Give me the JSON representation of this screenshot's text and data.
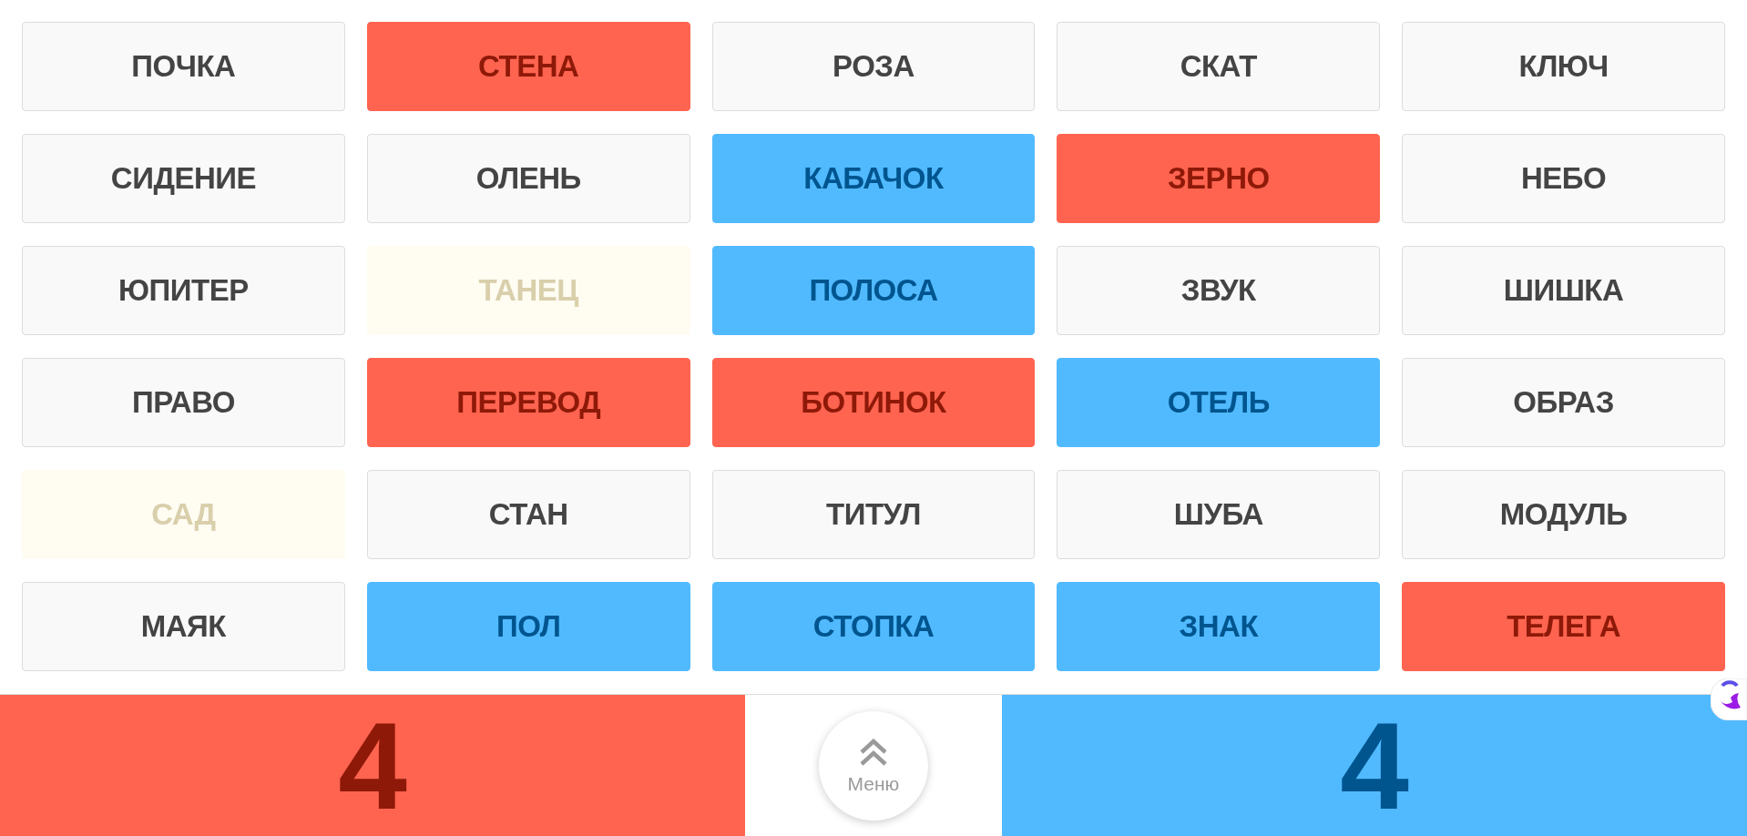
{
  "board": {
    "cards": [
      {
        "word": "ПОЧКА",
        "kind": "plain"
      },
      {
        "word": "СТЕНА",
        "kind": "red"
      },
      {
        "word": "РОЗА",
        "kind": "plain"
      },
      {
        "word": "СКАТ",
        "kind": "plain"
      },
      {
        "word": "КЛЮЧ",
        "kind": "plain"
      },
      {
        "word": "СИДЕНИЕ",
        "kind": "plain"
      },
      {
        "word": "ОЛЕНЬ",
        "kind": "plain"
      },
      {
        "word": "КАБАЧОК",
        "kind": "blue"
      },
      {
        "word": "ЗЕРНО",
        "kind": "red"
      },
      {
        "word": "НЕБО",
        "kind": "plain"
      },
      {
        "word": "ЮПИТЕР",
        "kind": "plain"
      },
      {
        "word": "ТАНЕЦ",
        "kind": "faded"
      },
      {
        "word": "ПОЛОСА",
        "kind": "blue"
      },
      {
        "word": "ЗВУК",
        "kind": "plain"
      },
      {
        "word": "ШИШКА",
        "kind": "plain"
      },
      {
        "word": "ПРАВО",
        "kind": "plain"
      },
      {
        "word": "ПЕРЕВОД",
        "kind": "red"
      },
      {
        "word": "БОТИНОК",
        "kind": "red"
      },
      {
        "word": "ОТЕЛЬ",
        "kind": "blue"
      },
      {
        "word": "ОБРАЗ",
        "kind": "plain"
      },
      {
        "word": "САД",
        "kind": "faded"
      },
      {
        "word": "СТАН",
        "kind": "plain"
      },
      {
        "word": "ТИТУЛ",
        "kind": "plain"
      },
      {
        "word": "ШУБА",
        "kind": "plain"
      },
      {
        "word": "МОДУЛЬ",
        "kind": "plain"
      },
      {
        "word": "МАЯК",
        "kind": "plain"
      },
      {
        "word": "ПОЛ",
        "kind": "blue"
      },
      {
        "word": "СТОПКА",
        "kind": "blue"
      },
      {
        "word": "ЗНАК",
        "kind": "blue"
      },
      {
        "word": "ТЕЛЕГА",
        "kind": "red"
      }
    ]
  },
  "score_bar": {
    "red_team": {
      "score": "4"
    },
    "menu_button": {
      "label": "Меню"
    },
    "blue_team": {
      "score": "4"
    }
  }
}
